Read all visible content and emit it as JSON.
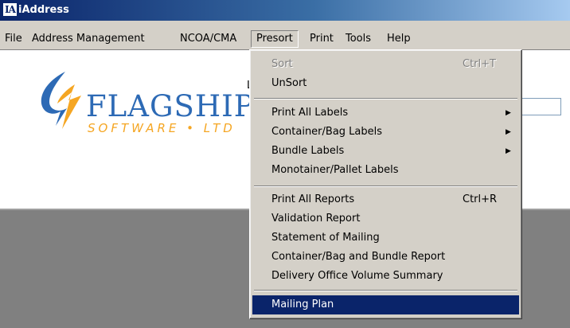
{
  "window": {
    "app_icon_text": "IA",
    "title": "iAddress"
  },
  "menubar": {
    "items": [
      {
        "label": "File"
      },
      {
        "label": "Address Management"
      },
      {
        "label": "NCOA/CMA"
      },
      {
        "label": "Presort"
      },
      {
        "label": "Print"
      },
      {
        "label": "Tools"
      },
      {
        "label": "Help"
      }
    ]
  },
  "background": {
    "logo_name": "FLAGSHIP",
    "logo_sub": "SOFTWARE • LTD",
    "partial_label": "L"
  },
  "presort_menu": {
    "items": [
      {
        "label": "Sort",
        "shortcut": "Ctrl+T",
        "disabled": true
      },
      {
        "label": "UnSort"
      },
      {
        "label": "Print All Labels",
        "submenu": true
      },
      {
        "label": "Container/Bag Labels",
        "submenu": true
      },
      {
        "label": "Bundle Labels",
        "submenu": true
      },
      {
        "label": "Monotainer/Pallet Labels"
      },
      {
        "label": "Print All Reports",
        "shortcut": "Ctrl+R"
      },
      {
        "label": "Validation Report"
      },
      {
        "label": "Statement of Mailing"
      },
      {
        "label": "Container/Bag and Bundle Report"
      },
      {
        "label": "Delivery Office Volume Summary"
      },
      {
        "label": "Mailing Plan",
        "selected": true
      }
    ],
    "submenu_arrow": "▶"
  },
  "colors": {
    "title_bar": "#0a246a",
    "menu_face": "#d4d0c8",
    "highlight": "#0a246a",
    "logo_blue": "#2d6ab5",
    "logo_orange": "#f5a623",
    "workspace": "#808080"
  }
}
